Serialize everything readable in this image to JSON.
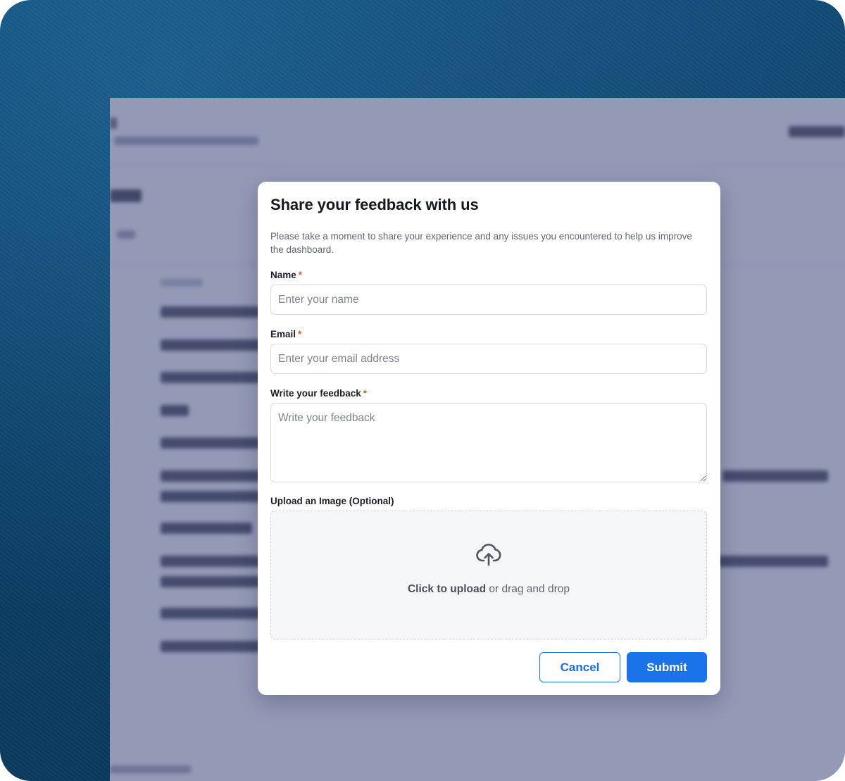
{
  "modal": {
    "title": "Share your feedback with us",
    "description": "Please take a moment to share your experience and any issues you encountered to help us improve the dashboard.",
    "required_marker": "*",
    "fields": {
      "name": {
        "label": "Name",
        "placeholder": "Enter your name",
        "value": ""
      },
      "email": {
        "label": "Email",
        "placeholder": "Enter your email address",
        "value": ""
      },
      "feedback": {
        "label": "Write your feedback",
        "placeholder": "Write your feedback",
        "value": ""
      }
    },
    "upload": {
      "label": "Upload an Image (Optional)",
      "action_text": "Click to upload",
      "rest_text": " or drag and drop",
      "icon": "cloud-upload-icon"
    },
    "buttons": {
      "cancel": "Cancel",
      "submit": "Submit"
    }
  },
  "colors": {
    "primary": "#1a73e8",
    "required": "#e2562b",
    "overlay": "#464e82"
  }
}
